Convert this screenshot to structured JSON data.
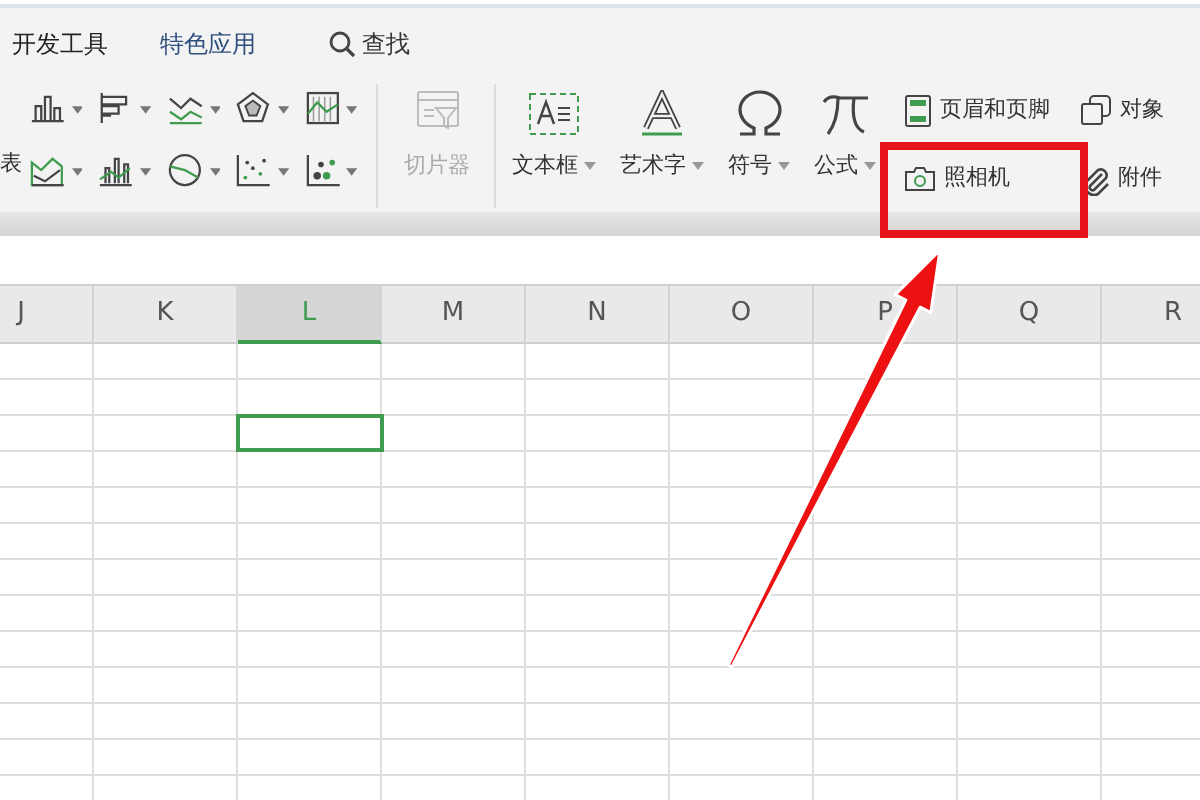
{
  "tabs": [
    {
      "label": "开发工具",
      "kind": "text"
    },
    {
      "label": "特色应用",
      "kind": "text"
    },
    {
      "label": "查找",
      "kind": "search"
    }
  ],
  "ribbon": {
    "cut_label": "表",
    "slicer": {
      "label": "切片器",
      "disabled": true
    },
    "big_buttons": [
      {
        "label": "文本框",
        "kind": "textbox",
        "dropdown": true
      },
      {
        "label": "艺术字",
        "kind": "wordart",
        "dropdown": true
      },
      {
        "label": "符号",
        "kind": "omega",
        "dropdown": true
      },
      {
        "label": "公式",
        "kind": "pi",
        "dropdown": true
      }
    ],
    "small_buttons": [
      {
        "label": "页眉和页脚",
        "kind": "header"
      },
      {
        "label": "照相机",
        "kind": "camera"
      },
      {
        "label": "对象",
        "kind": "object"
      },
      {
        "label": "附件",
        "kind": "clip"
      }
    ]
  },
  "sheet": {
    "columns": [
      {
        "label": "J",
        "selected": false
      },
      {
        "label": "K",
        "selected": false
      },
      {
        "label": "L",
        "selected": true
      },
      {
        "label": "M",
        "selected": false
      },
      {
        "label": "N",
        "selected": false
      },
      {
        "label": "O",
        "selected": false
      },
      {
        "label": "P",
        "selected": false
      },
      {
        "label": "Q",
        "selected": false
      },
      {
        "label": "R",
        "selected": false
      }
    ],
    "rows": [
      {
        "selected": false
      },
      {
        "selected": false
      },
      {
        "selected": true
      },
      {
        "selected": false
      },
      {
        "selected": false
      },
      {
        "selected": false
      },
      {
        "selected": false
      },
      {
        "selected": false
      },
      {
        "selected": false
      },
      {
        "selected": false
      },
      {
        "selected": false
      },
      {
        "selected": false
      },
      {
        "selected": false
      }
    ]
  }
}
